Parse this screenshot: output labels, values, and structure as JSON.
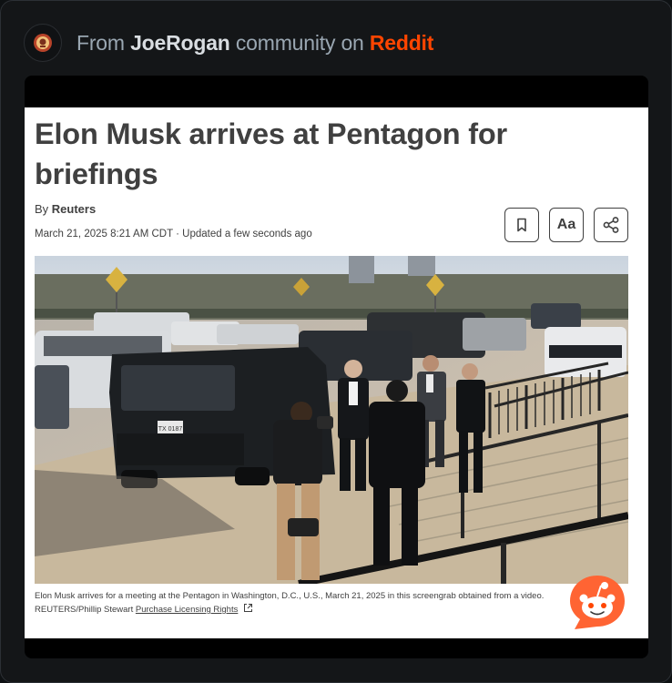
{
  "header": {
    "prefix": "From",
    "community": "JoeRogan",
    "middle": "community on",
    "platform": "Reddit"
  },
  "article": {
    "headline": "Elon Musk arrives at Pentagon for briefings",
    "byline_prefix": "By",
    "byline_source": "Reuters",
    "dateline": "March 21, 2025 8:21 AM CDT · Updated a few seconds ago",
    "tools": {
      "bookmark_icon": "bookmark-icon",
      "text_size_label": "Aa",
      "share_icon": "share-icon"
    },
    "caption_line1": "Elon Musk arrives for a meeting at the Pentagon in Washington, D.C., U.S., March 21, 2025 in this screengrab obtained from a video.",
    "caption_credit": "REUTERS/Phillip Stewart",
    "caption_link": "Purchase Licensing Rights",
    "plate_text": "TX 0187"
  },
  "colors": {
    "reddit_orange": "#ff4500",
    "background": "#141618",
    "header_text": "#9aa7b2",
    "article_text": "#404040"
  }
}
